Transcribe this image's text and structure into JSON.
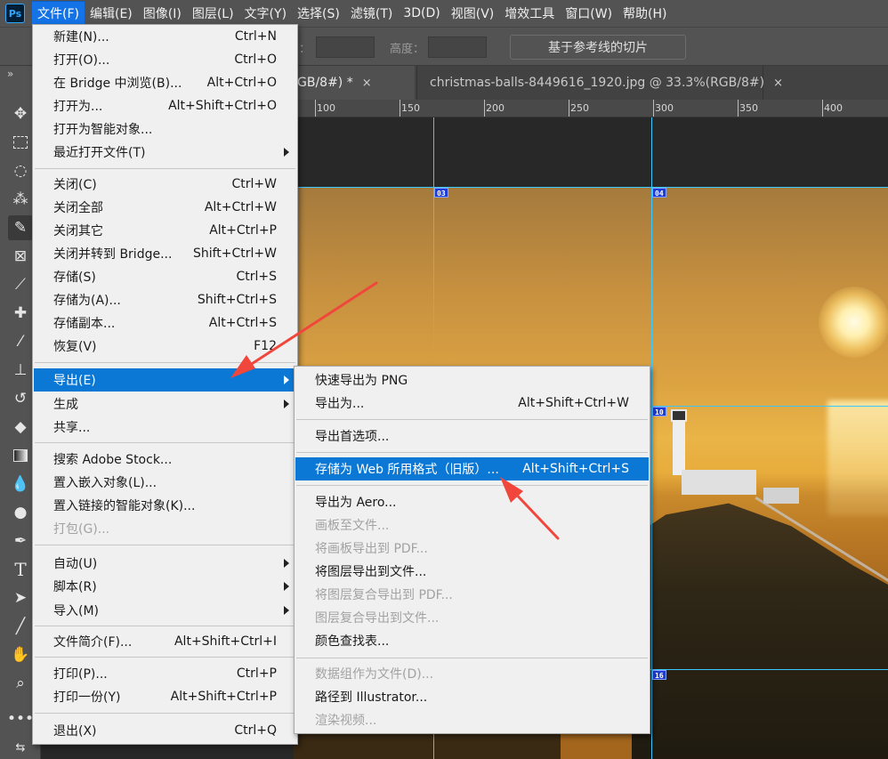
{
  "app": {
    "logo": "Ps"
  },
  "menubar": [
    {
      "label": "文件(F)"
    },
    {
      "label": "编辑(E)"
    },
    {
      "label": "图像(I)"
    },
    {
      "label": "图层(L)"
    },
    {
      "label": "文字(Y)"
    },
    {
      "label": "选择(S)"
    },
    {
      "label": "滤镜(T)"
    },
    {
      "label": "3D(D)"
    },
    {
      "label": "视图(V)"
    },
    {
      "label": "增效工具"
    },
    {
      "label": "窗口(W)"
    },
    {
      "label": "帮助(H)"
    }
  ],
  "options_bar": {
    "partial_label": "：",
    "height_label": "高度：",
    "slice_button": "基于参考线的切片"
  },
  "tools": [
    {
      "icon": "move-icon"
    },
    {
      "icon": "marquee-icon"
    },
    {
      "icon": "lasso-icon"
    },
    {
      "icon": "magic-wand-icon"
    },
    {
      "icon": "slice-tool-icon"
    },
    {
      "icon": "frame-icon"
    },
    {
      "icon": "eyedropper-icon"
    },
    {
      "icon": "healing-brush-icon"
    },
    {
      "icon": "brush-icon"
    },
    {
      "icon": "stamp-icon"
    },
    {
      "icon": "history-brush-icon"
    },
    {
      "icon": "eraser-icon"
    },
    {
      "icon": "gradient-icon"
    },
    {
      "icon": "blur-icon"
    },
    {
      "icon": "dodge-icon"
    },
    {
      "icon": "pen-icon"
    },
    {
      "icon": "type-icon"
    },
    {
      "icon": "path-selection-icon"
    },
    {
      "icon": "line-icon"
    },
    {
      "icon": "hand-icon"
    },
    {
      "icon": "zoom-icon"
    },
    {
      "icon": "more-tools-icon"
    }
  ],
  "tabs": [
    {
      "label": "GB/8#) *",
      "close": "×"
    },
    {
      "label": "christmas-balls-8449616_1920.jpg @ 33.3%(RGB/8#)",
      "close": "×"
    }
  ],
  "ruler": {
    "ticks": [
      "100",
      "150",
      "200",
      "250",
      "300",
      "350",
      "400"
    ]
  },
  "slices": [
    "03",
    "04",
    "10",
    "16"
  ],
  "file_menu": {
    "items": [
      {
        "label": "新建(N)...",
        "shortcut": "Ctrl+N"
      },
      {
        "label": "打开(O)...",
        "shortcut": "Ctrl+O"
      },
      {
        "label": "在 Bridge 中浏览(B)...",
        "shortcut": "Alt+Ctrl+O"
      },
      {
        "label": "打开为...",
        "shortcut": "Alt+Shift+Ctrl+O"
      },
      {
        "label": "打开为智能对象..."
      },
      {
        "label": "最近打开文件(T)"
      },
      {
        "label": "关闭(C)",
        "shortcut": "Ctrl+W"
      },
      {
        "label": "关闭全部",
        "shortcut": "Alt+Ctrl+W"
      },
      {
        "label": "关闭其它",
        "shortcut": "Alt+Ctrl+P"
      },
      {
        "label": "关闭并转到 Bridge...",
        "shortcut": "Shift+Ctrl+W"
      },
      {
        "label": "存储(S)",
        "shortcut": "Ctrl+S"
      },
      {
        "label": "存储为(A)...",
        "shortcut": "Shift+Ctrl+S"
      },
      {
        "label": "存储副本...",
        "shortcut": "Alt+Ctrl+S"
      },
      {
        "label": "恢复(V)",
        "shortcut": "F12"
      },
      {
        "label": "导出(E)"
      },
      {
        "label": "生成"
      },
      {
        "label": "共享..."
      },
      {
        "label": "搜索 Adobe Stock..."
      },
      {
        "label": "置入嵌入对象(L)..."
      },
      {
        "label": "置入链接的智能对象(K)..."
      },
      {
        "label": "打包(G)..."
      },
      {
        "label": "自动(U)"
      },
      {
        "label": "脚本(R)"
      },
      {
        "label": "导入(M)"
      },
      {
        "label": "文件简介(F)...",
        "shortcut": "Alt+Shift+Ctrl+I"
      },
      {
        "label": "打印(P)...",
        "shortcut": "Ctrl+P"
      },
      {
        "label": "打印一份(Y)",
        "shortcut": "Alt+Shift+Ctrl+P"
      },
      {
        "label": "退出(X)",
        "shortcut": "Ctrl+Q"
      }
    ]
  },
  "export_menu": {
    "items": [
      {
        "label": "快速导出为 PNG"
      },
      {
        "label": "导出为...",
        "shortcut": "Alt+Shift+Ctrl+W"
      },
      {
        "label": "导出首选项..."
      },
      {
        "label": "存储为 Web 所用格式（旧版）...",
        "shortcut": "Alt+Shift+Ctrl+S"
      },
      {
        "label": "导出为 Aero..."
      },
      {
        "label": "画板至文件..."
      },
      {
        "label": "将画板导出到 PDF..."
      },
      {
        "label": "将图层导出到文件..."
      },
      {
        "label": "将图层复合导出到 PDF..."
      },
      {
        "label": "图层复合导出到文件..."
      },
      {
        "label": "颜色查找表..."
      },
      {
        "label": "数据组作为文件(D)..."
      },
      {
        "label": "路径到 Illustrator..."
      },
      {
        "label": "渲染视频..."
      }
    ]
  },
  "colors": {
    "highlight": "#0c78d6",
    "guide": "#38c7ff",
    "arrow": "#f0463c",
    "slice_badge": "#1d3bd6"
  }
}
